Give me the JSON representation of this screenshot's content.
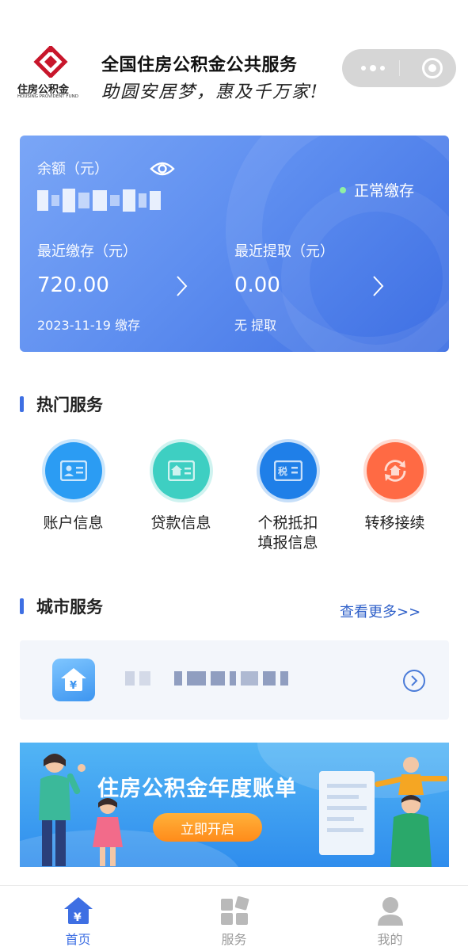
{
  "header": {
    "logo_text_cn": "住房公积金",
    "logo_text_en": "HOUSING PROVIDENT FUND",
    "title": "全国住房公积金公共服务",
    "slogan": "助圆安居梦，惠及千万家!"
  },
  "balance_card": {
    "balance_label": "余额（元）",
    "status_text": "正常缴存",
    "recent_deposit": {
      "label": "最近缴存（元）",
      "amount": "720.00",
      "detail": "2023-11-19 缴存"
    },
    "recent_withdraw": {
      "label": "最近提取（元）",
      "amount": "0.00",
      "detail": "无 提取"
    }
  },
  "hot_services": {
    "title": "热门服务",
    "items": [
      {
        "label": "账户信息",
        "icon": "id-card-icon",
        "color": "#2b9cf3"
      },
      {
        "label": "贷款信息",
        "icon": "house-card-icon",
        "color": "#3ecfc2"
      },
      {
        "label": "个税抵扣\n填报信息",
        "icon": "tax-icon",
        "color": "#1f7fe8"
      },
      {
        "label": "转移接续",
        "icon": "transfer-house-icon",
        "color": "#ff6a45"
      }
    ]
  },
  "city_services": {
    "title": "城市服务",
    "more_label": "查看更多>>"
  },
  "banner": {
    "title": "住房公积金年度账单",
    "button_label": "立即开启"
  },
  "tabbar": {
    "items": [
      {
        "label": "首页",
        "active": true
      },
      {
        "label": "服务",
        "active": false
      },
      {
        "label": "我的",
        "active": false
      }
    ]
  },
  "colors": {
    "accent": "#3e6fe3",
    "card_gradient_start": "#7aa6f6",
    "card_gradient_end": "#3e6fe3",
    "status_dot": "#8ff0a4",
    "banner_button": "#ff8b1a"
  }
}
